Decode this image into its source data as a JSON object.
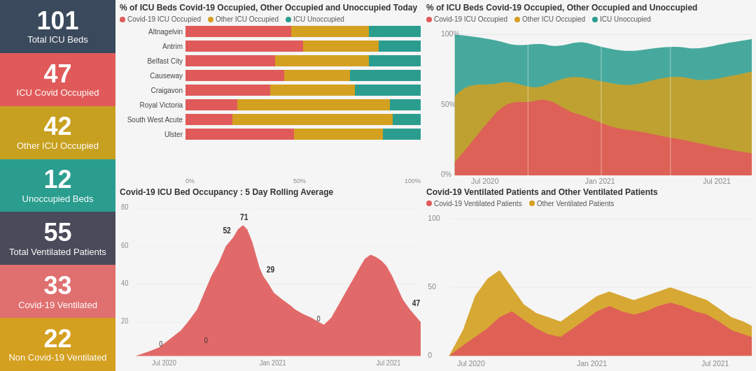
{
  "sidebar": {
    "cards": [
      {
        "num": "101",
        "label": "Total ICU Beds",
        "color": "card-dark-blue"
      },
      {
        "num": "47",
        "label": "ICU Covid Occupied",
        "color": "card-red"
      },
      {
        "num": "42",
        "label": "Other ICU Occupied",
        "color": "card-gold"
      },
      {
        "num": "12",
        "label": "Unoccupied Beds",
        "color": "card-teal"
      },
      {
        "num": "55",
        "label": "Total Ventilated Patients",
        "color": "card-dark-gray"
      },
      {
        "num": "33",
        "label": "Covid-19 Ventilated",
        "color": "card-salmon"
      },
      {
        "num": "22",
        "label": "Non Covid-19 Ventilated",
        "color": "card-amber"
      }
    ]
  },
  "topLeft": {
    "title": "% of ICU Beds Covid-19 Occupied, Other Occupied and Unoccupied Today",
    "legend": [
      {
        "label": "Covid-19 ICU Occupied",
        "color": "#e05a5a"
      },
      {
        "label": "Other ICU Occupied",
        "color": "#d4a020"
      },
      {
        "label": "ICU Unoccupied",
        "color": "#2a9d8f"
      }
    ],
    "bars": [
      {
        "label": "Altnagelvin",
        "covid": 45,
        "other": 33,
        "unoccupied": 22
      },
      {
        "label": "Antrim",
        "covid": 50,
        "other": 32,
        "unoccupied": 18
      },
      {
        "label": "Belfast City",
        "covid": 38,
        "other": 40,
        "unoccupied": 22
      },
      {
        "label": "Causeway",
        "covid": 42,
        "other": 28,
        "unoccupied": 30
      },
      {
        "label": "Craigavon",
        "covid": 36,
        "other": 36,
        "unoccupied": 28
      },
      {
        "label": "Royal Victoria",
        "covid": 22,
        "other": 65,
        "unoccupied": 13
      },
      {
        "label": "South West Acute",
        "covid": 20,
        "other": 68,
        "unoccupied": 12
      },
      {
        "label": "Ulster",
        "covid": 46,
        "other": 38,
        "unoccupied": 16
      }
    ],
    "axisLabels": [
      "0%",
      "50%",
      "100%"
    ]
  },
  "topRight": {
    "title": "% of ICU Beds Covid-19 Occupied, Other Occupied and Unoccupied",
    "legend": [
      {
        "label": "Covid-19 ICU Occupied",
        "color": "#e05a5a"
      },
      {
        "label": "Other ICU Occupied",
        "color": "#d4a020"
      },
      {
        "label": "ICU Unoccupied",
        "color": "#2a9d8f"
      }
    ],
    "yLabels": [
      "100%",
      "50%",
      "0%"
    ],
    "xLabels": [
      "Jul 2020",
      "Jan 2021",
      "Jul 2021"
    ]
  },
  "bottomLeft": {
    "title": "Covid-19 ICU Bed Occupancy : 5 Day Rolling Average",
    "yMax": 80,
    "peaks": [
      {
        "label": "71",
        "x": 0.52
      },
      {
        "label": "52",
        "x": 0.38
      },
      {
        "label": "29",
        "x": 0.44
      },
      {
        "label": "47",
        "x": 0.97
      },
      {
        "label": "0",
        "x": 0.2
      },
      {
        "label": "0",
        "x": 0.305
      },
      {
        "label": "0",
        "x": 0.66
      }
    ],
    "xLabels": [
      "Jul 2020",
      "Jan 2021",
      "Jul 2021"
    ],
    "yLabels": [
      "80",
      "60",
      "40",
      "20"
    ]
  },
  "bottomRight": {
    "title": "Covid-19 Ventilated Patients and Other Ventilated Patients",
    "legend": [
      {
        "label": "Covid-19 Ventilated Patients",
        "color": "#e05a5a"
      },
      {
        "label": "Other Ventilated Patients",
        "color": "#d4a020"
      }
    ],
    "yLabels": [
      "100",
      "50",
      "0"
    ],
    "xLabels": [
      "Jul 2020",
      "Jan 2021",
      "Jul 2021"
    ]
  },
  "colors": {
    "covid": "#e05a5a",
    "other": "#d4a020",
    "unoccupied": "#2a9d8f",
    "covidVent": "#e05a5a",
    "otherVent": "#d4a020"
  }
}
